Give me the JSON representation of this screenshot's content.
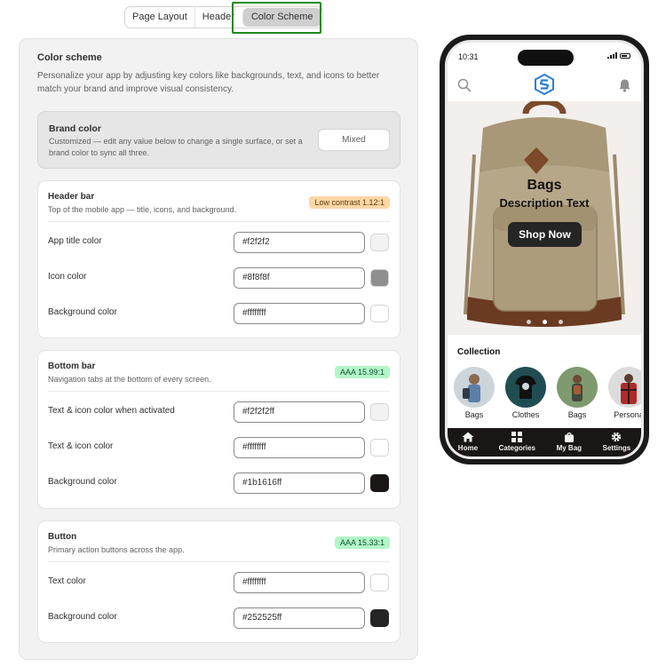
{
  "tabs": [
    {
      "label": "Page Layout",
      "active": false
    },
    {
      "label": "Header",
      "active": false
    },
    {
      "label": "Color Scheme",
      "active": true
    }
  ],
  "panel": {
    "title": "Color scheme",
    "description": "Personalize your app by adjusting key colors like backgrounds, text, and icons to better match your brand and improve visual consistency."
  },
  "brand": {
    "title": "Brand color",
    "description": "Customized — edit any value below to change a single surface, or set a brand color to sync all three.",
    "button": "Mixed"
  },
  "header_bar": {
    "title": "Header bar",
    "description": "Top of the mobile app — title, icons, and background.",
    "badge": "Low contrast 1.12:1",
    "rows": [
      {
        "label": "App title color",
        "value": "#f2f2f2",
        "swatch": "#f2f2f2"
      },
      {
        "label": "Icon color",
        "value": "#8f8f8f",
        "swatch": "#8f8f8f"
      },
      {
        "label": "Background color",
        "value": "#ffffffff",
        "swatch": "#ffffff"
      }
    ]
  },
  "bottom_bar": {
    "title": "Bottom bar",
    "description": "Navigation tabs at the bottom of every screen.",
    "badge": "AAA 15.99:1",
    "rows": [
      {
        "label": "Text & icon color when activated",
        "value": "#f2f2f2ff",
        "swatch": "#f2f2f2"
      },
      {
        "label": "Text & icon color",
        "value": "#ffffffff",
        "swatch": "#ffffff"
      },
      {
        "label": "Background color",
        "value": "#1b1616ff",
        "swatch": "#1b1616"
      }
    ]
  },
  "button_section": {
    "title": "Button",
    "description": "Primary action buttons across the app.",
    "badge": "AAA 15.33:1",
    "rows": [
      {
        "label": "Text color",
        "value": "#ffffffff",
        "swatch": "#ffffff"
      },
      {
        "label": "Background color",
        "value": "#252525ff",
        "swatch": "#252525"
      }
    ]
  },
  "phone": {
    "time": "10:31",
    "hero_title": "Bags",
    "hero_subtitle": "Description Text",
    "hero_button": "Shop Now",
    "carousel_active_index": 1,
    "collection_title": "Collection",
    "collection": [
      {
        "label": "Bags",
        "icon": "person-with-bag-image"
      },
      {
        "label": "Clothes",
        "icon": "tshirt-image"
      },
      {
        "label": "Bags",
        "icon": "backpack-outdoor-image"
      },
      {
        "label": "Persona",
        "icon": "plaid-shirt-image"
      }
    ],
    "nav": [
      {
        "label": "Home",
        "icon": "home-icon"
      },
      {
        "label": "Categories",
        "icon": "grid-icon"
      },
      {
        "label": "My Bag",
        "icon": "bag-icon"
      },
      {
        "label": "Settings",
        "icon": "gear-icon"
      }
    ]
  },
  "colors": {
    "tab_highlight": "#1a8a1a",
    "brand_logo": "#2a7fd4"
  }
}
